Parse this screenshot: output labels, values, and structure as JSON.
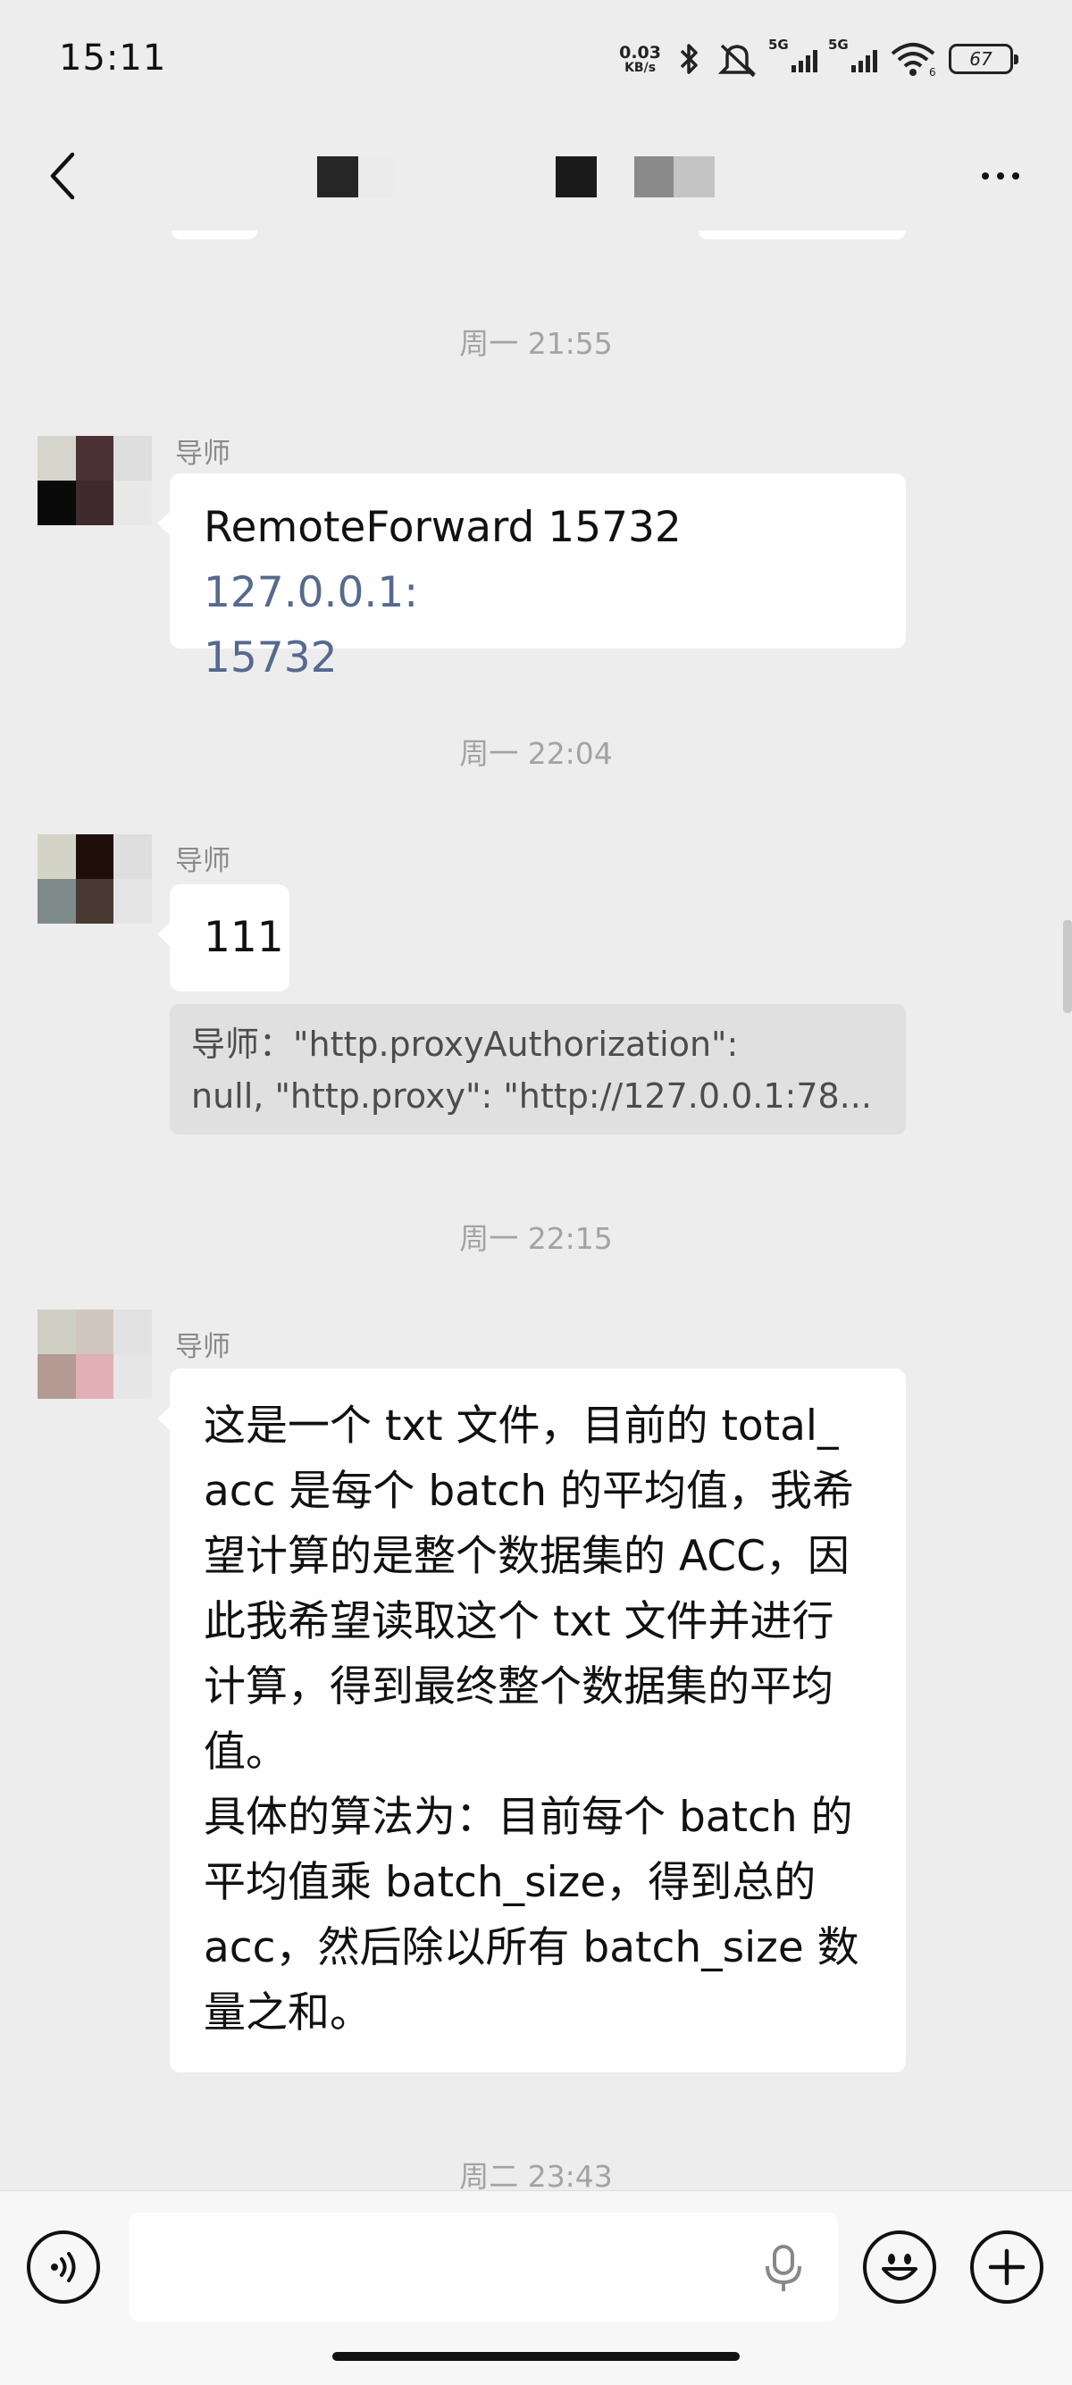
{
  "status_bar": {
    "time": "15:11",
    "net_speed_value": "0.03",
    "net_speed_unit": "KB/s",
    "sim1_label": "5G",
    "sim2_label": "5G",
    "wifi_label": "6",
    "battery": "67"
  },
  "header": {
    "back_icon": "chevron-left-icon",
    "more_icon": "more-horizontal-icon"
  },
  "messages": [
    {
      "timestamp": "周一 21:55",
      "sender": "导师",
      "text_plain": "RemoteForward 15732 ",
      "text_link_1": "127.0.0.1:",
      "text_link_2": "15732"
    },
    {
      "timestamp": "周一 22:04",
      "sender": "导师",
      "text": "111",
      "quote_line_1": "导师：\"http.proxyAuthorization\":",
      "quote_line_2": "null,     \"http.proxy\": \"http://127.0.0.1:78..."
    },
    {
      "timestamp": "周一 22:15",
      "sender": "导师",
      "lines": [
        "这是一个 txt 文件，目前的 total_",
        "acc 是每个 batch 的平均值，我希",
        "望计算的是整个数据集的 ACC，因",
        "此我希望读取这个 txt 文件并进行",
        "计算，得到最终整个数据集的平均",
        "值。",
        "具体的算法为：目前每个 batch 的",
        "平均值乘 batch_size，得到总的",
        "acc，然后除以所有 batch_size 数",
        "量之和。"
      ]
    },
    {
      "timestamp": "周二 23:43"
    }
  ],
  "input_bar": {
    "voice_icon": "voice-mode-icon",
    "mic_icon": "microphone-icon",
    "emoji_icon": "emoji-icon",
    "plus_icon": "plus-icon",
    "input_value": ""
  }
}
